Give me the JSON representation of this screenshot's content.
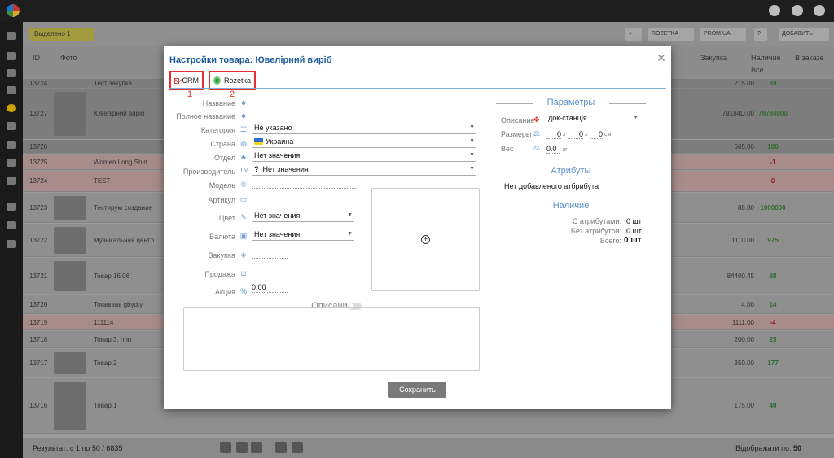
{
  "background": {
    "filter_badge": "Выделено 1",
    "toolbar_buttons": [
      "ROZETKA",
      "PROM.UA",
      "ДОБАВИТЬ"
    ],
    "table_headers": {
      "id": "ID",
      "photo": "Фото",
      "purchase": "Закупка",
      "stock": "Наличие",
      "stock_filter": "Все",
      "in_order": "В заказе"
    },
    "rows": [
      {
        "id": "13724",
        "name": "Тест закупка",
        "price": "215.00",
        "stock": "89",
        "style": "gray"
      },
      {
        "id": "13727",
        "name": "Ювелірний виріб",
        "price": "79184D.00",
        "stock": "79784000",
        "style": "gray"
      },
      {
        "id": "13726",
        "name": "",
        "price": "565.00",
        "stock": "100",
        "style": "gray"
      },
      {
        "id": "13725",
        "name": "Women Long Shirt",
        "price": "",
        "stock": "-1",
        "style": "pink"
      },
      {
        "id": "13724",
        "name": "TEST",
        "price": "",
        "stock": "0",
        "style": "pink"
      },
      {
        "id": "13723",
        "name": "Тестирую создание",
        "price": "88.80",
        "stock": "1000000",
        "style": ""
      },
      {
        "id": "13722",
        "name": "Музыкальная центр",
        "price": "1110.00",
        "stock": "975",
        "style": ""
      },
      {
        "id": "13721",
        "name": "Товар 16.06",
        "price": "84400.45",
        "stock": "88",
        "style": ""
      },
      {
        "id": "13720",
        "name": "Товвввав gbydty",
        "price": "4.00",
        "stock": "14",
        "style": ""
      },
      {
        "id": "13719",
        "name": "111114",
        "price": "1111.00",
        "stock": "-4",
        "style": "pink"
      },
      {
        "id": "13718",
        "name": "Товар 3, nnn",
        "price": "200.00",
        "stock": "25",
        "style": ""
      },
      {
        "id": "13717",
        "name": "Товар 2",
        "price": "350.00",
        "stock": "177",
        "style": ""
      },
      {
        "id": "13716",
        "name": "Товар 1",
        "price": "175.00",
        "stock": "40",
        "style": ""
      }
    ],
    "footer_text": "Результат: с 1 по 50 / 6835",
    "footer_right": "Відображати по:",
    "per_page": "50"
  },
  "modal": {
    "title": "Настройки товара: Ювелірний виріб",
    "close": "✕",
    "tabs": [
      {
        "label": "CRM",
        "number": "1"
      },
      {
        "label": "Rozetka",
        "number": "2"
      }
    ],
    "fields": {
      "name_label": "Название",
      "fullname_label": "Полное название",
      "category_label": "Категория",
      "category_value": "Не указано",
      "country_label": "Страна",
      "country_value": "Украина",
      "department_label": "Отдел",
      "department_value": "Нет значения",
      "manufacturer_label": "Производитель",
      "manufacturer_value": "Нет значения",
      "model_label": "Модель",
      "article_label": "Артикул",
      "color_label": "Цвет",
      "color_value": "Нет значения",
      "currency_label": "Валюта",
      "currency_value": "Нет значения",
      "purchase_label": "Закупка",
      "sale_label": "Продажа",
      "promo_label": "Акция",
      "promo_value": "0.00"
    },
    "description_title": "Описание",
    "save_label": "Сохранить",
    "parameters": {
      "title": "Параметры",
      "desc_label": "Описание",
      "desc_value": "док-станція",
      "size_label": "Размеры",
      "size_x": "0",
      "size_y": "0",
      "size_z": "0",
      "size_sep": "x",
      "size_unit": "см",
      "weight_label": "Вес",
      "weight_value": "0.0",
      "weight_unit": "кг"
    },
    "attributes": {
      "title": "Атрибуты",
      "empty_text": "Нет добавленого атбрибута"
    },
    "availability": {
      "title": "Наличие",
      "with_attr_label": "С атрибутами:",
      "with_attr_value": "0 шт",
      "without_attr_label": "Без атрибутов:",
      "without_attr_value": "0 шт",
      "total_label": "Всего:",
      "total_value": "0 шт"
    }
  }
}
